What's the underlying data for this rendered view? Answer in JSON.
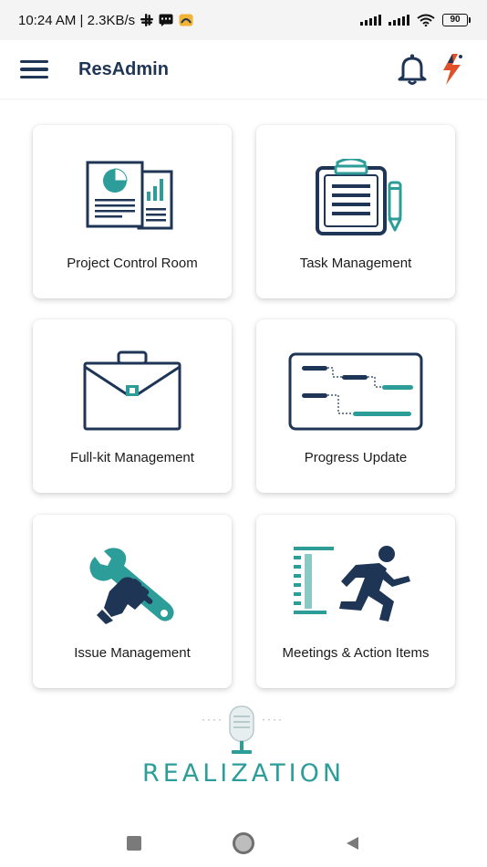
{
  "status_bar": {
    "time_speed": "10:24 AM | 2.3KB/s",
    "battery": "90"
  },
  "app_bar": {
    "title": "ResAdmin"
  },
  "tiles": [
    {
      "label": "Project Control Room",
      "icon": "report-document-icon"
    },
    {
      "label": "Task Management",
      "icon": "clipboard-icon"
    },
    {
      "label": "Full-kit Management",
      "icon": "briefcase-icon"
    },
    {
      "label": "Progress Update",
      "icon": "gantt-chart-icon"
    },
    {
      "label": "Issue Management",
      "icon": "wrench-glove-icon"
    },
    {
      "label": "Meetings & Action Items",
      "icon": "running-person-icon"
    }
  ],
  "brand": {
    "name": "REALIZATION"
  },
  "colors": {
    "navy": "#1f3556",
    "teal": "#2c9d99",
    "accent_bolt": "#e0502a",
    "background": "#ffffff"
  }
}
